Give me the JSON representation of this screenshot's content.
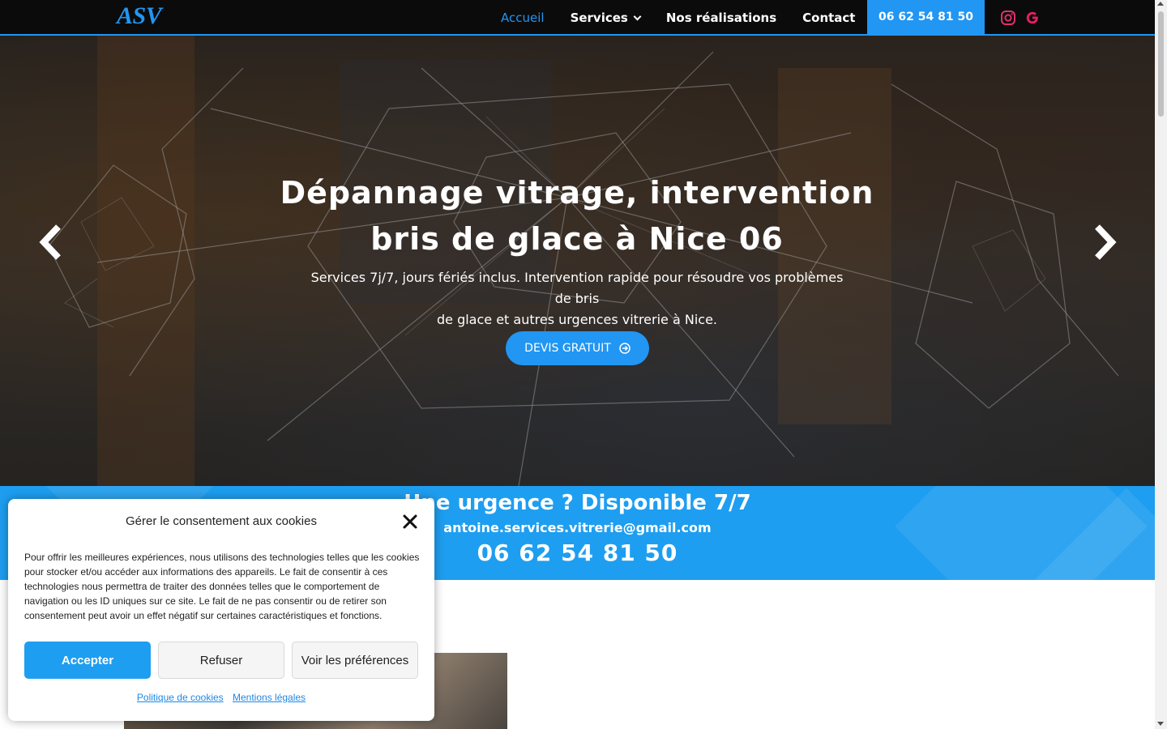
{
  "header": {
    "logo": "ASV",
    "nav": [
      {
        "label": "Accueil"
      },
      {
        "label": "Services"
      },
      {
        "label": "Nos réalisations"
      },
      {
        "label": "Contact"
      }
    ],
    "phone_button": "06 62 54 81 50",
    "social": [
      "instagram-icon",
      "google-icon"
    ]
  },
  "hero": {
    "title_line1": "Dépannage vitrage, intervention",
    "title_line2": "bris de glace à Nice 06",
    "subtitle_line1": "Services 7j/7, jours fériés inclus. Intervention rapide pour résoudre vos problèmes de bris",
    "subtitle_line2": "de glace et autres urgences vitrerie à Nice.",
    "cta": "DEVIS GRATUIT"
  },
  "band": {
    "title": "Une urgence ? Disponible 7/7",
    "email": "antoine.services.vitrerie@gmail.com",
    "phone": "06 62 54 81 50"
  },
  "cookie": {
    "title": "Gérer le consentement aux cookies",
    "text": "Pour offrir les meilleures expériences, nous utilisons des technologies telles que les cookies pour stocker et/ou accéder aux informations des appareils. Le fait de consentir à ces technologies nous permettra de traiter des données telles que le comportement de navigation ou les ID uniques sur ce site. Le fait de ne pas consentir ou de retirer son consentement peut avoir un effet négatif sur certaines caractéristiques et fonctions.",
    "accept": "Accepter",
    "refuse": "Refuser",
    "prefs": "Voir les préférences",
    "link_policy": "Politique de cookies",
    "link_legal": "Mentions légales"
  },
  "colors": {
    "accent": "#2196f3",
    "header_bg": "#0b0b0b",
    "band_bg": "#1e9ef0"
  }
}
